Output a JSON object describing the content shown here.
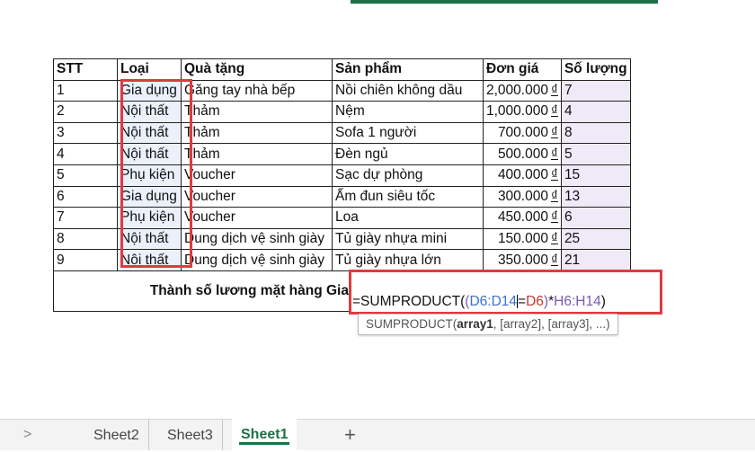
{
  "table": {
    "headers": [
      "STT",
      "Loại",
      "Quà tặng",
      "Sản phẩm",
      "Đơn giá",
      "Số lượng"
    ],
    "currency_symbol": "₫",
    "rows": [
      {
        "stt": "1",
        "loai": "Gia dụng",
        "gift": "Găng tay nhà bếp",
        "product": "Nồi chiên không dầu",
        "price": "2,000.000",
        "qty": "7"
      },
      {
        "stt": "2",
        "loai": "Nội thất",
        "gift": "Thảm",
        "product": "Nệm",
        "price": "1,000.000",
        "qty": "4"
      },
      {
        "stt": "3",
        "loai": "Nội thất",
        "gift": "Thảm",
        "product": "Sofa 1 người",
        "price": "700.000",
        "qty": "8"
      },
      {
        "stt": "4",
        "loai": "Nội thất",
        "gift": "Thảm",
        "product": "Đèn ngủ",
        "price": "500.000",
        "qty": "5"
      },
      {
        "stt": "5",
        "loai": "Phụ kiện",
        "gift": "Voucher",
        "product": "Sạc dự phòng",
        "price": "400.000",
        "qty": "15"
      },
      {
        "stt": "6",
        "loai": "Gia dụng",
        "gift": "Voucher",
        "product": "Ấm đun siêu tốc",
        "price": "300.000",
        "qty": "13"
      },
      {
        "stt": "7",
        "loai": "Phụ kiện",
        "gift": "Voucher",
        "product": "Loa",
        "price": "450.000",
        "qty": "6"
      },
      {
        "stt": "8",
        "loai": "Nội thất",
        "gift": "Dung dịch vệ sinh giày",
        "product": "Tủ giày nhựa mini",
        "price": "150.000",
        "qty": "25"
      },
      {
        "stt": "9",
        "loai": "Nội thất",
        "gift": "Dung dịch vệ sinh giày",
        "product": "Tủ giày nhựa lớn",
        "price": "350.000",
        "qty": "21"
      }
    ],
    "summary_label": "Thành số lương mặt hàng Gia dụng"
  },
  "formula": {
    "prefix": "=SUMPRODUCT(",
    "open_paren": "(",
    "ref1": "D6:D14",
    "equals": "=",
    "ref2": "D6",
    "close_paren": ")",
    "times": "*",
    "ref3": "H6:H14",
    "end": ")"
  },
  "tooltip": {
    "func": "SUMPRODUCT(",
    "arg1": "array1",
    "rest": ", [array2], [array3], ...)"
  },
  "sheets": {
    "nav_icon": ">",
    "tabs": [
      "Sheet2",
      "Sheet3",
      "Sheet1"
    ],
    "active": "Sheet1",
    "add_icon": "+"
  },
  "colors": {
    "highlight_border": "#e03a3e",
    "ref_blue": "#3b6fd8",
    "ref_red": "#c0392b",
    "ref_purple": "#7a5bb0",
    "excel_green": "#1e7145"
  }
}
